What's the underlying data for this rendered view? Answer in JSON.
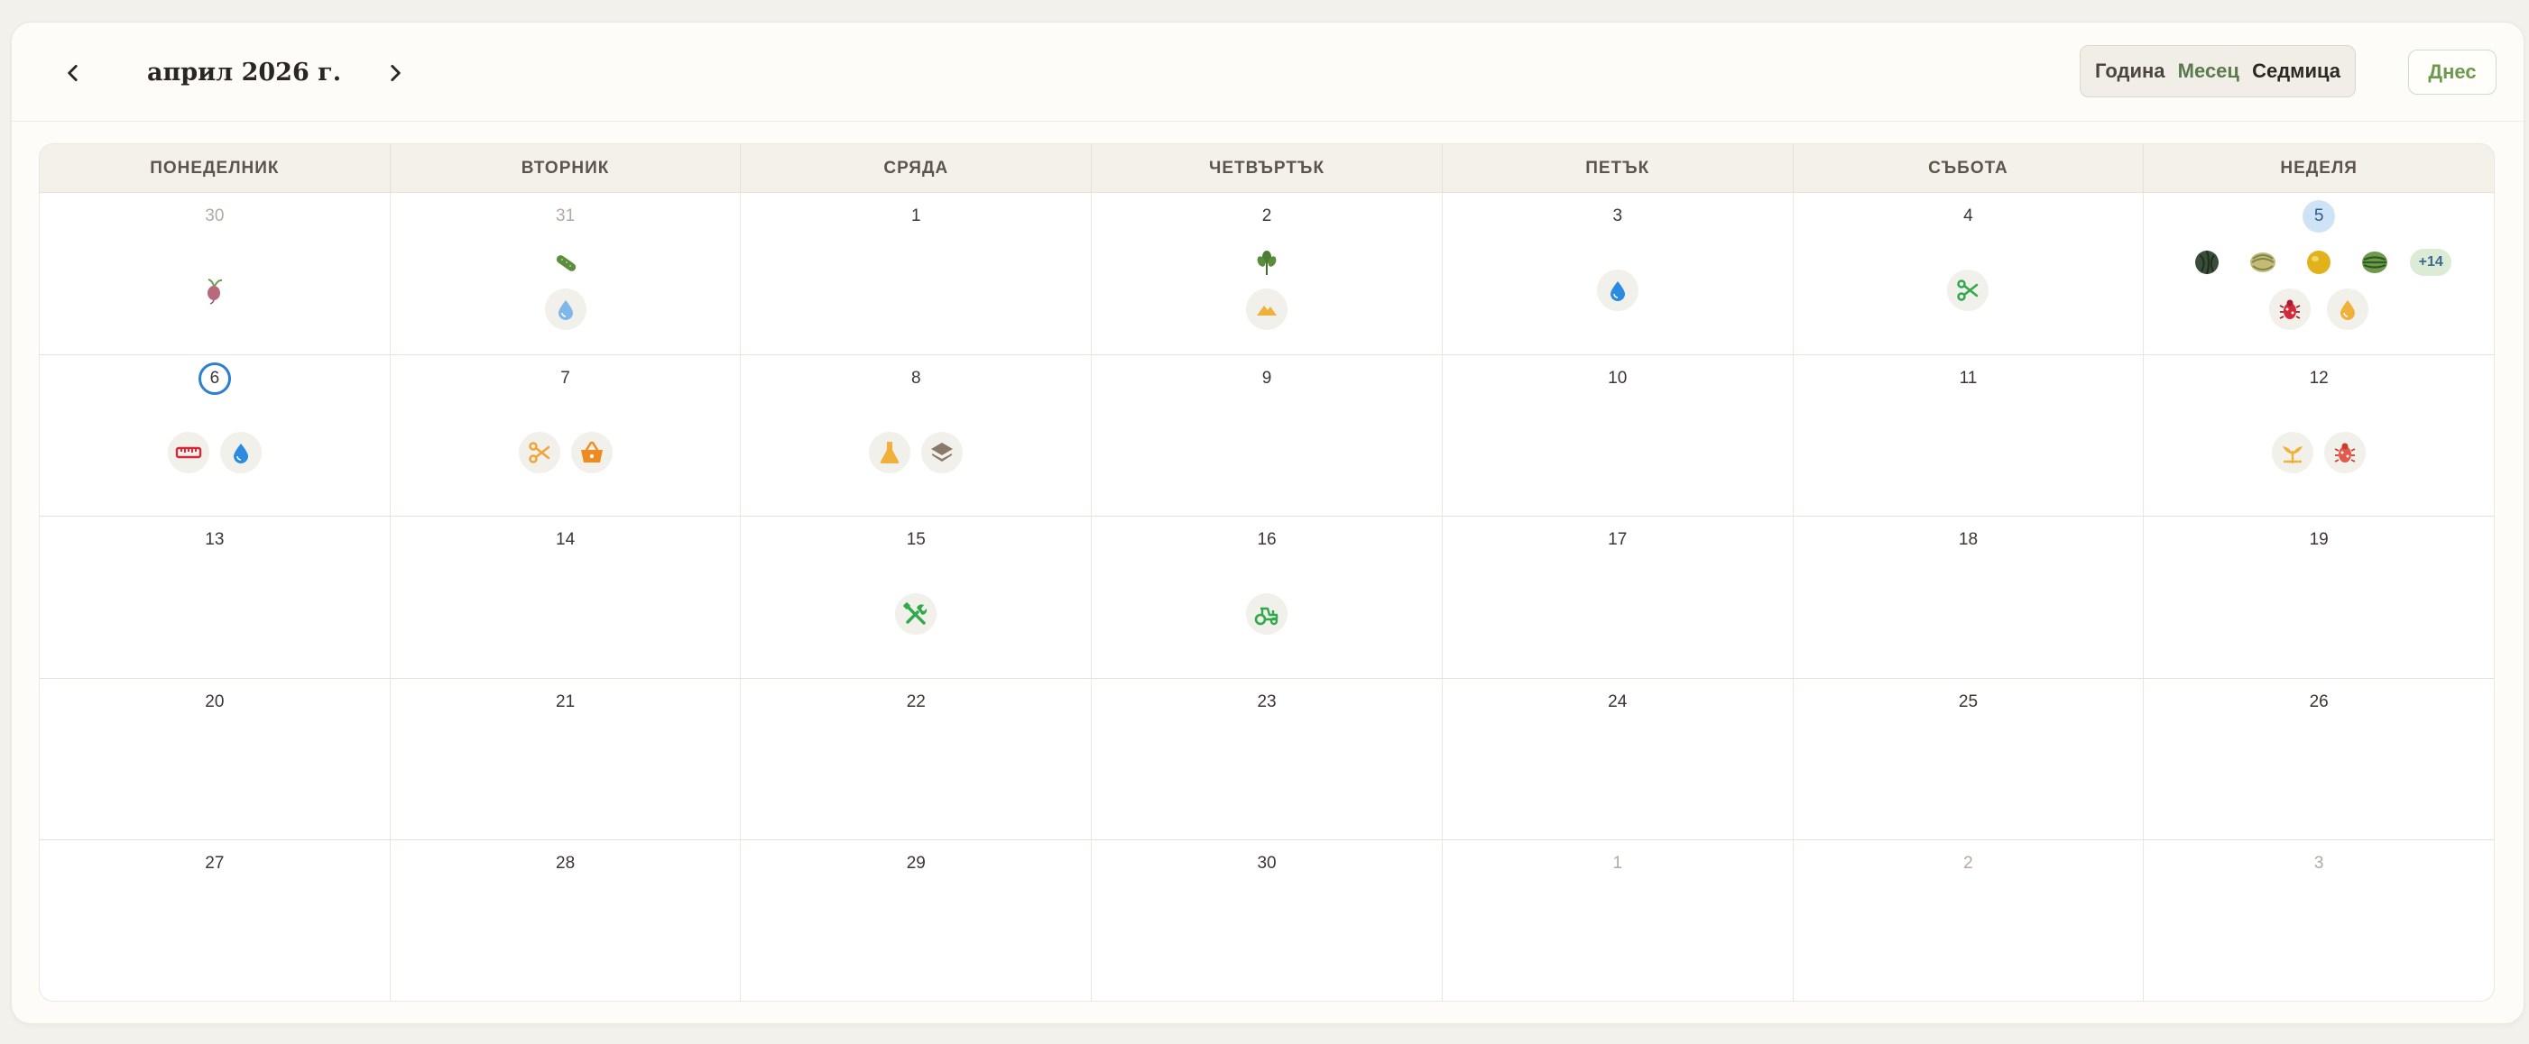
{
  "header": {
    "month_title": "април 2026 г.",
    "views": {
      "year": "Година",
      "month": "Месец",
      "week": "Седмица"
    },
    "today_label": "Днес"
  },
  "weekdays": [
    "ПОНЕДЕЛНИК",
    "ВТОРНИК",
    "СРЯДА",
    "ЧЕТВЪРТЪК",
    "ПЕТЪК",
    "СЪБОТА",
    "НЕДЕЛЯ"
  ],
  "weeks": [
    [
      "30",
      "31",
      "1",
      "2",
      "3",
      "4",
      "5"
    ],
    [
      "6",
      "7",
      "8",
      "9",
      "10",
      "11",
      "12"
    ],
    [
      "13",
      "14",
      "15",
      "16",
      "17",
      "18",
      "19"
    ],
    [
      "20",
      "21",
      "22",
      "23",
      "24",
      "25",
      "26"
    ],
    [
      "27",
      "28",
      "29",
      "30",
      "1",
      "2",
      "3"
    ]
  ],
  "more_events_badge": "+14",
  "colors": {
    "accent_green": "#6b9a4e",
    "today_ring": "#2d7fd0",
    "highlight_day": "#cfe3f7"
  },
  "icons": {
    "beet": "beet-icon",
    "cucumber": "cucumber-icon",
    "water": "water-drop-icon",
    "herb": "herb-icon",
    "soil": "soil-mound-icon",
    "prune": "scissors-icon",
    "pest": "bug-icon",
    "fertilizer": "fertilizer-drop-icon",
    "measure": "ruler-icon",
    "harvest": "basket-icon",
    "lab": "flask-icon",
    "layers": "layers-icon",
    "sprout": "sprout-icon",
    "tools": "tools-icon",
    "tractor": "tractor-icon"
  }
}
